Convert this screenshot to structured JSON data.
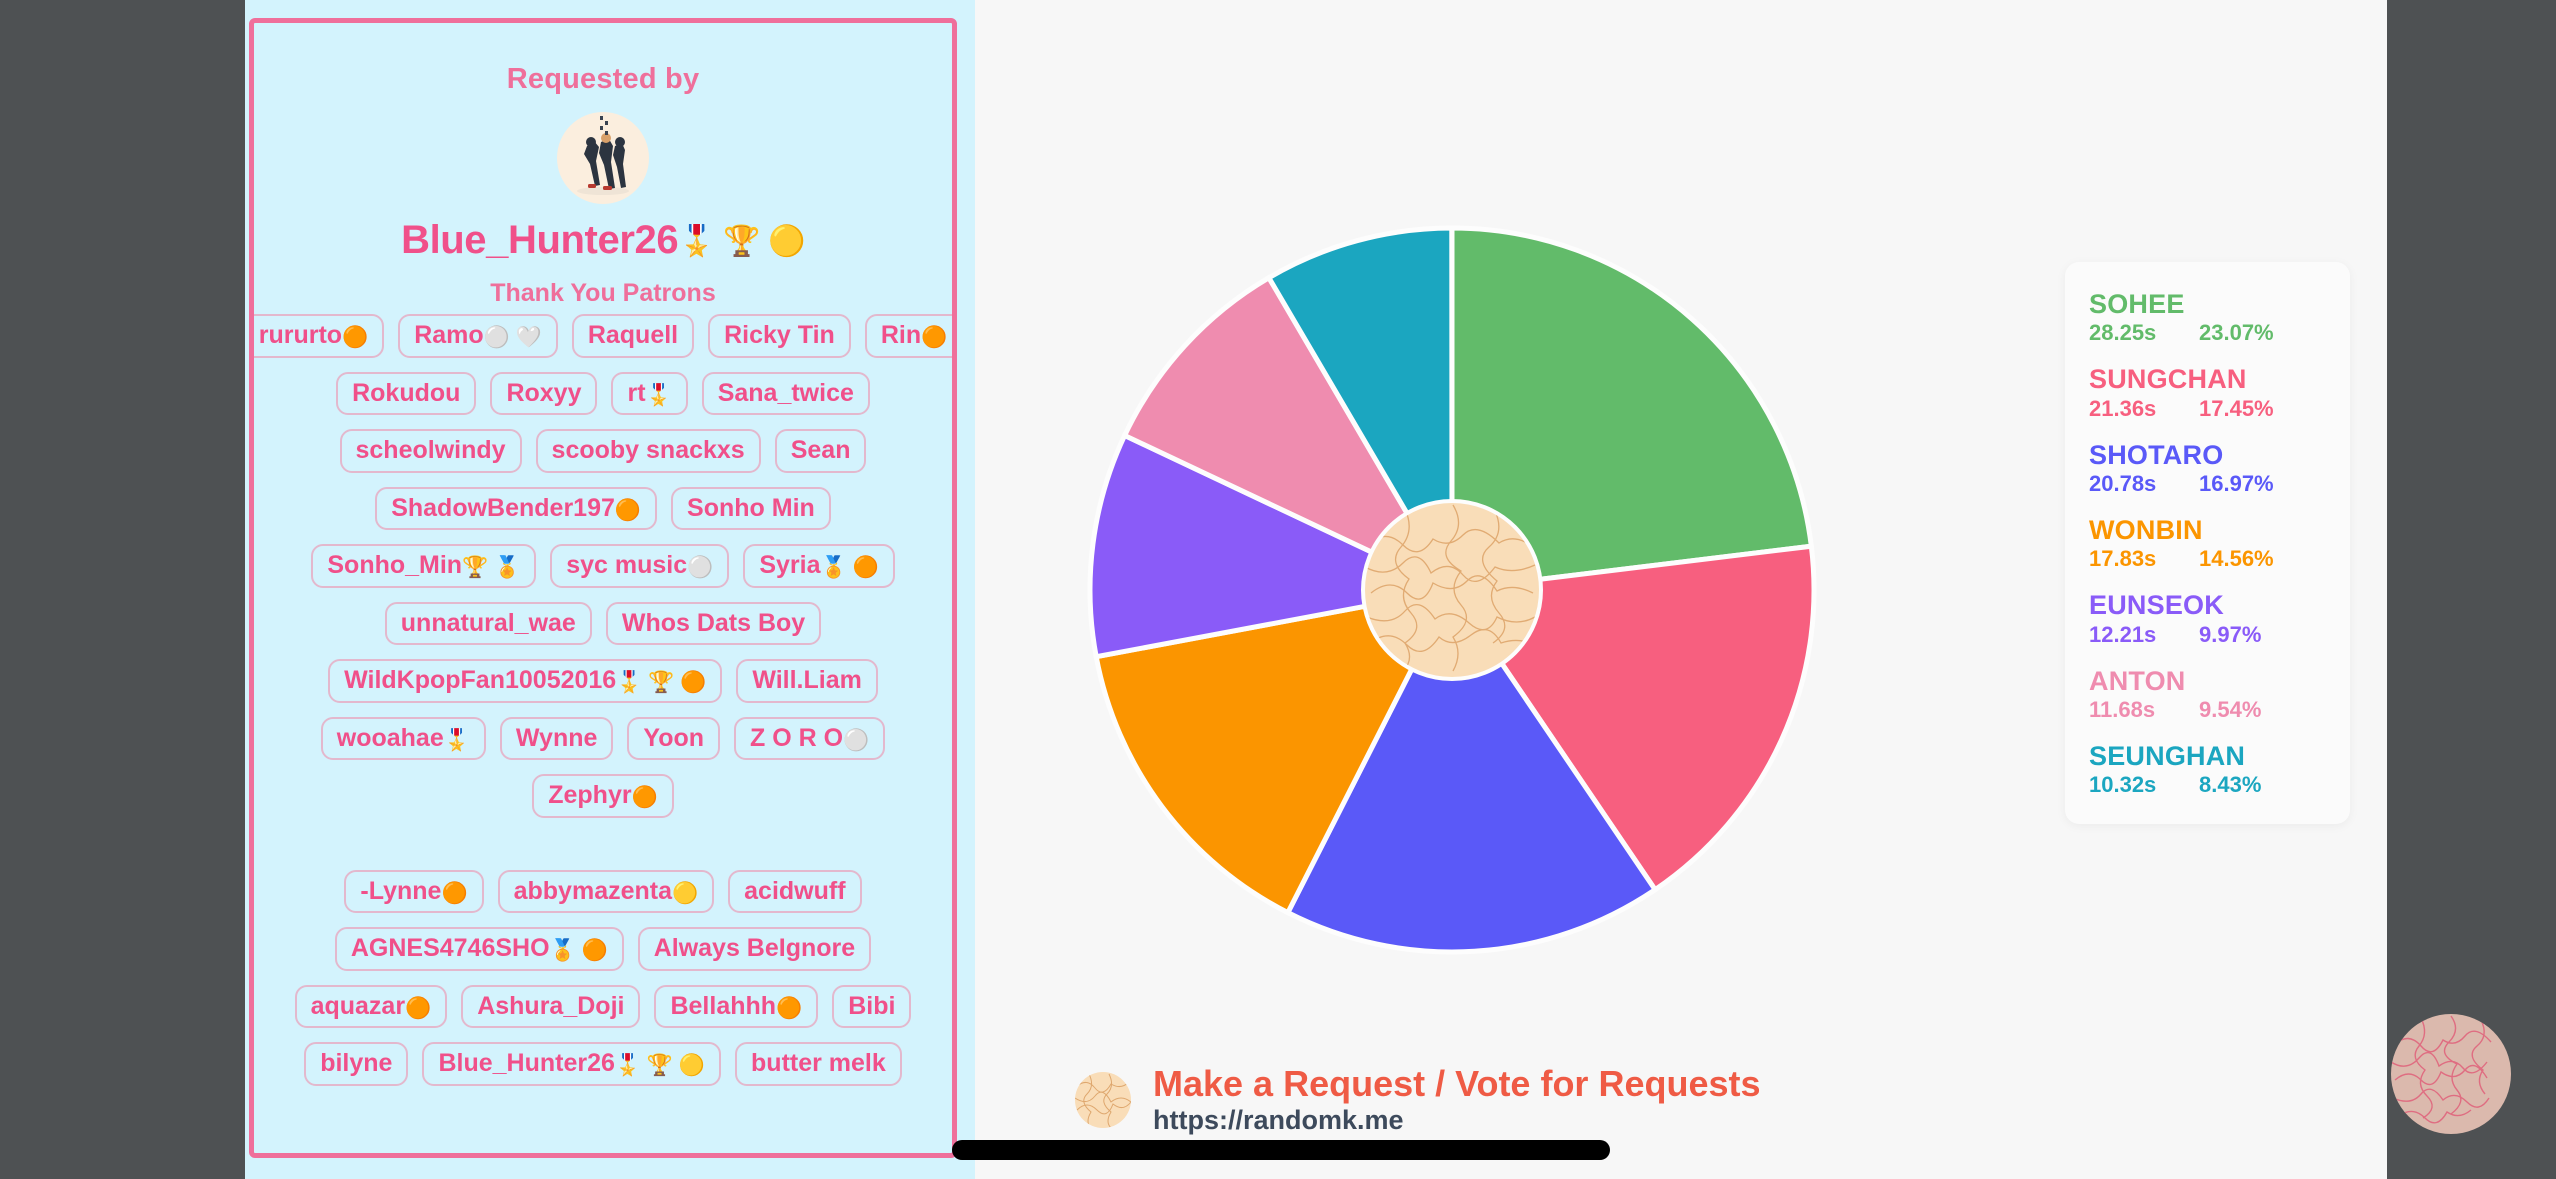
{
  "theme": {
    "backdrop": "#4e5153",
    "panel_bg": "#d3f3fd",
    "panel_border": "#ef6f9b",
    "stage_bg": "#f7f7f7",
    "accent_pink": "#f0508a",
    "cta_orange": "#ef5b45",
    "cta_url_color": "#3d4a5c"
  },
  "patron_panel": {
    "requested_by_label": "Requested by",
    "avatar_icon": "dancers-avatar",
    "requester": {
      "name": "Blue_Hunter26",
      "badges": "🎖️ 🏆 🟡"
    },
    "thank_you_label": "Thank You Patrons",
    "tag_rows": [
      [
        {
          "label": "rururto",
          "badges": "🟠"
        },
        {
          "label": "Ramo",
          "badges": "⚪ 🤍"
        },
        {
          "label": "Raquell",
          "badges": ""
        },
        {
          "label": "Ricky Tin",
          "badges": ""
        },
        {
          "label": "Rin",
          "badges": "🟠"
        }
      ],
      [
        {
          "label": "Rokudou",
          "badges": ""
        },
        {
          "label": "Roxyy",
          "badges": ""
        },
        {
          "label": "rt",
          "badges": "🎖️"
        },
        {
          "label": "Sana_twice",
          "badges": ""
        }
      ],
      [
        {
          "label": "scheolwindy",
          "badges": ""
        },
        {
          "label": "scooby snackxs",
          "badges": ""
        },
        {
          "label": "Sean",
          "badges": ""
        }
      ],
      [
        {
          "label": "ShadowBender197",
          "badges": "🟠"
        },
        {
          "label": "Sonho Min",
          "badges": ""
        }
      ],
      [
        {
          "label": "Sonho_Min",
          "badges": "🏆 🏅"
        },
        {
          "label": "syc music",
          "badges": "⚪"
        },
        {
          "label": "Syria",
          "badges": "🏅 🟠"
        }
      ],
      [
        {
          "label": "unnatural_wae",
          "badges": ""
        },
        {
          "label": "Whos Dats Boy",
          "badges": ""
        }
      ],
      [
        {
          "label": "WildKpopFan10052016",
          "badges": "🎖️ 🏆 🟠"
        },
        {
          "label": "Will.Liam",
          "badges": ""
        }
      ],
      [
        {
          "label": "wooahae",
          "badges": "🎖️"
        },
        {
          "label": "Wynne",
          "badges": ""
        },
        {
          "label": "Yoon",
          "badges": ""
        },
        {
          "label": "Z O R O",
          "badges": "⚪"
        }
      ],
      [
        {
          "label": "Zephyr",
          "badges": "🟠"
        }
      ],
      [
        {
          "label": "-Lynne",
          "badges": "🟠"
        },
        {
          "label": "abbymazenta",
          "badges": "🟡"
        },
        {
          "label": "acidwuff",
          "badges": ""
        }
      ],
      [
        {
          "label": "AGNES4746SHO",
          "badges": "🏅 🟠"
        },
        {
          "label": "Always BeIgnore",
          "badges": ""
        }
      ],
      [
        {
          "label": "aquazar",
          "badges": "🟠"
        },
        {
          "label": "Ashura_Doji",
          "badges": ""
        },
        {
          "label": "Bellahhh",
          "badges": "🟠"
        },
        {
          "label": "Bibi",
          "badges": ""
        }
      ],
      [
        {
          "label": "bilyne",
          "badges": ""
        },
        {
          "label": "Blue_Hunter26",
          "badges": "🎖️ 🏆 🟡"
        },
        {
          "label": "butter melk",
          "badges": ""
        }
      ]
    ]
  },
  "chart_data": {
    "type": "pie",
    "title": "",
    "unit": "s",
    "start_angle_deg": 0,
    "legend_position": "right",
    "categories": [
      "SOHEE",
      "SUNGCHAN",
      "SHOTARO",
      "WONBIN",
      "EUNSEOK",
      "ANTON",
      "SEUNGHAN"
    ],
    "values": [
      28.25,
      21.36,
      20.78,
      17.83,
      12.21,
      11.68,
      10.32
    ],
    "percents": [
      23.07,
      17.45,
      16.97,
      14.56,
      9.97,
      9.54,
      8.43
    ],
    "colors": [
      "#62bb6a",
      "#f75f7f",
      "#5a59f8",
      "#fb9500",
      "#8a5bf8",
      "#ef8caf",
      "#1ba6c0"
    ],
    "slices": [
      {
        "name": "SOHEE",
        "time": "28.25s",
        "percent": "23.07%",
        "value": 28.25,
        "pct": 23.07,
        "color": "#62bb6a"
      },
      {
        "name": "SUNGCHAN",
        "time": "21.36s",
        "percent": "17.45%",
        "value": 21.36,
        "pct": 17.45,
        "color": "#f75f7f"
      },
      {
        "name": "SHOTARO",
        "time": "20.78s",
        "percent": "16.97%",
        "value": 20.78,
        "pct": 16.97,
        "color": "#5a59f8"
      },
      {
        "name": "WONBIN",
        "time": "17.83s",
        "percent": "14.56%",
        "value": 17.83,
        "pct": 14.56,
        "color": "#fb9500"
      },
      {
        "name": "EUNSEOK",
        "time": "12.21s",
        "percent": "9.97%",
        "value": 12.21,
        "pct": 9.97,
        "color": "#8a5bf8"
      },
      {
        "name": "ANTON",
        "time": "11.68s",
        "percent": "9.54%",
        "value": 11.68,
        "pct": 9.54,
        "color": "#ef8caf"
      },
      {
        "name": "SEUNGHAN",
        "time": "10.32s",
        "percent": "8.43%",
        "value": 10.32,
        "pct": 8.43,
        "color": "#1ba6c0"
      }
    ]
  },
  "cta": {
    "icon": "squiggle-circle-icon",
    "title": "Make a Request / Vote for Requests",
    "url": "https://randomk.me"
  },
  "corner_logo": {
    "icon": "squiggle-circle-logo"
  }
}
